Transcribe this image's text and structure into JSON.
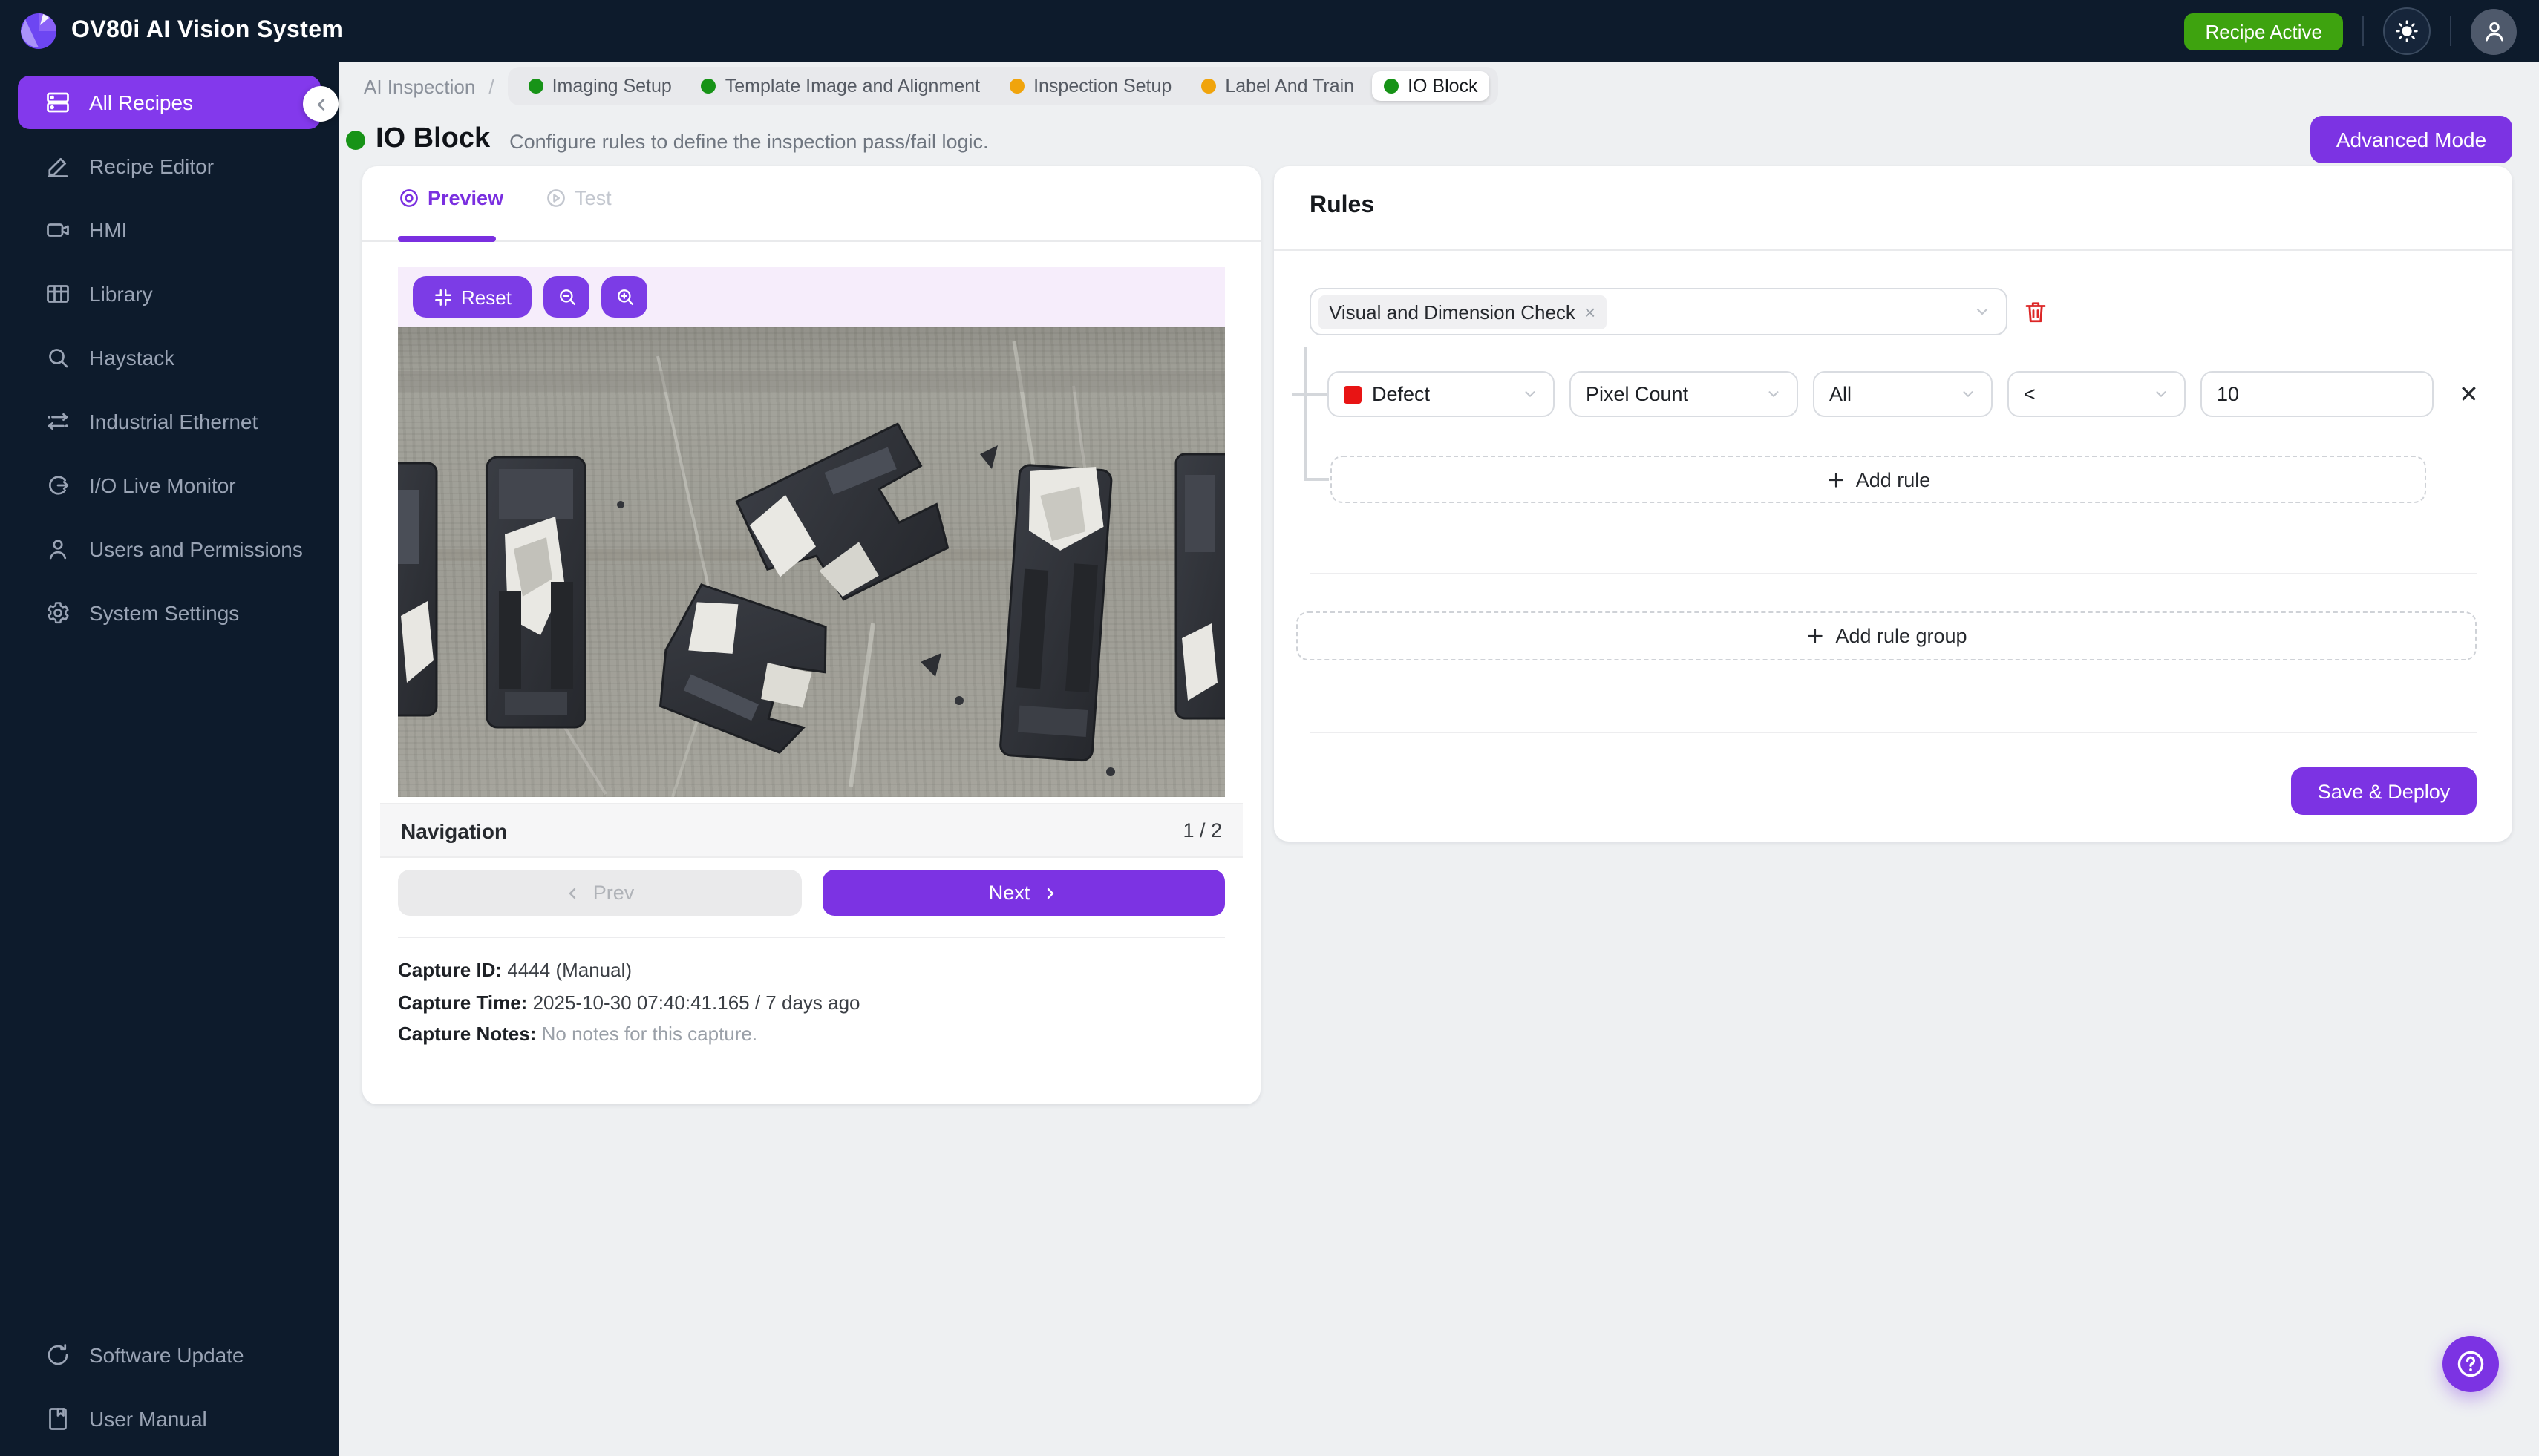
{
  "topbar": {
    "title": "OV80i AI Vision System",
    "recipe_status": "Recipe Active"
  },
  "sidebar": {
    "items": [
      {
        "label": "All Recipes",
        "active": true
      },
      {
        "label": "Recipe Editor"
      },
      {
        "label": "HMI"
      },
      {
        "label": "Library"
      },
      {
        "label": "Haystack"
      },
      {
        "label": "Industrial Ethernet"
      },
      {
        "label": "I/O Live Monitor"
      },
      {
        "label": "Users and Permissions"
      },
      {
        "label": "System Settings"
      }
    ],
    "footer_items": [
      {
        "label": "Software Update"
      },
      {
        "label": "User Manual"
      }
    ]
  },
  "breadcrumb": {
    "root": "AI Inspection",
    "separator": "/",
    "steps": [
      {
        "label": "Imaging Setup",
        "status": "green"
      },
      {
        "label": "Template Image and Alignment",
        "status": "green"
      },
      {
        "label": "Inspection Setup",
        "status": "amber"
      },
      {
        "label": "Label And Train",
        "status": "amber"
      },
      {
        "label": "IO Block",
        "status": "green",
        "active": true
      }
    ]
  },
  "page": {
    "title": "IO Block",
    "subtitle": "Configure rules to define the inspection pass/fail logic.",
    "advanced_mode_label": "Advanced Mode"
  },
  "preview_panel": {
    "tabs": [
      {
        "label": "Preview",
        "active": true
      },
      {
        "label": "Test",
        "active": false
      }
    ],
    "toolbar": {
      "reset_label": "Reset"
    },
    "navigation": {
      "label": "Navigation",
      "page_indicator": "1 / 2",
      "prev_label": "Prev",
      "next_label": "Next"
    },
    "capture": {
      "id_label": "Capture ID:",
      "id_value": "4444 (Manual)",
      "time_label": "Capture Time:",
      "time_value": "2025-10-30 07:40:41.165 / 7 days ago",
      "notes_label": "Capture Notes:",
      "notes_value": "No notes for this capture."
    }
  },
  "rules_panel": {
    "title": "Rules",
    "group_tag": "Visual and Dimension Check",
    "rule": {
      "target": "Defect",
      "metric": "Pixel Count",
      "scope": "All",
      "operator": "<",
      "value": "10"
    },
    "add_rule_label": "Add rule",
    "add_rule_group_label": "Add rule group",
    "save_label": "Save & Deploy"
  },
  "colors": {
    "primary_purple": "#7c33e3",
    "sidebar_navy": "#0d1b2c",
    "badge_green": "#3ea30f",
    "status_green": "#179317",
    "status_amber": "#f0a40c",
    "defect_red": "#e81414"
  }
}
